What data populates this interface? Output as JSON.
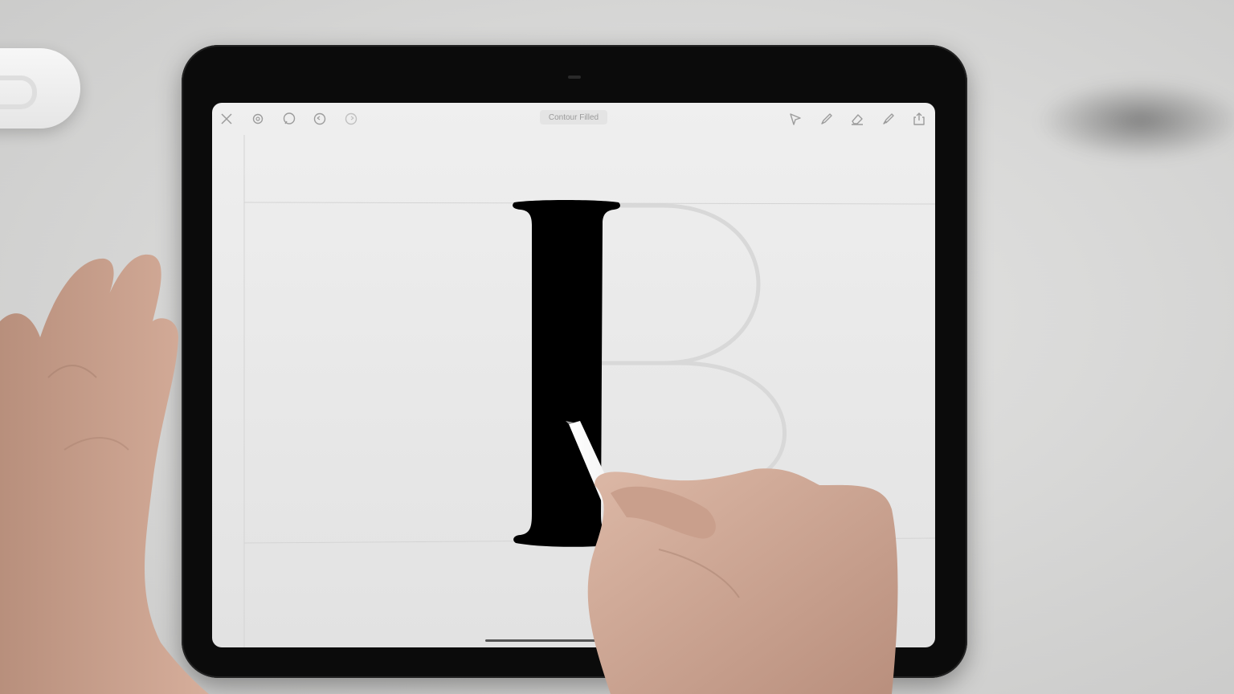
{
  "document": {
    "title": "Contour Filled"
  },
  "toolbar": {
    "left_icons": [
      "close-icon",
      "settings-icon",
      "comment-icon",
      "undo-icon",
      "redo-icon"
    ],
    "right_icons": [
      "select-arrow-icon",
      "pen-icon",
      "eraser-icon",
      "brush-icon",
      "share-icon"
    ]
  },
  "canvas": {
    "drawn_glyph": "I",
    "guide_glyph": "B"
  },
  "colors": {
    "ink": "#000000",
    "guide": "#d6d6d6",
    "icon": "#9c9c9c"
  }
}
